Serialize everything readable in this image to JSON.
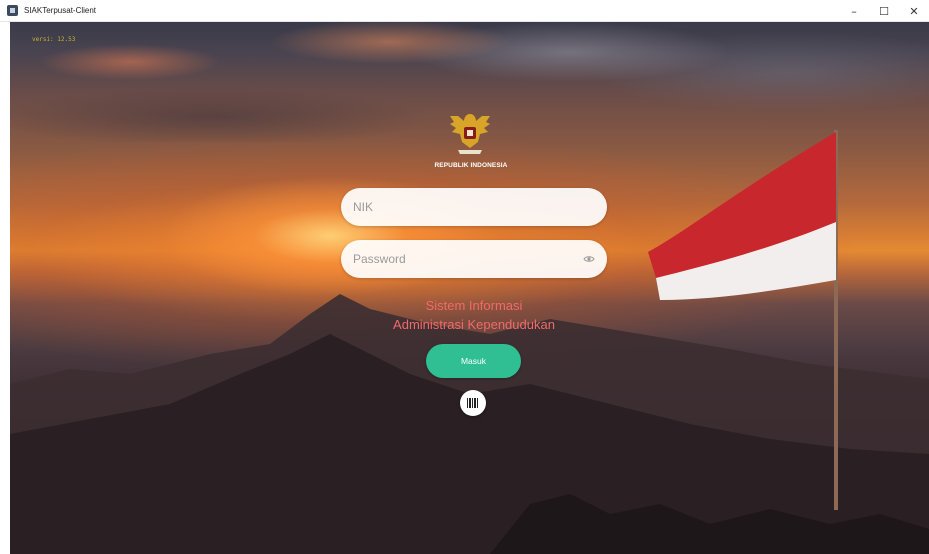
{
  "window": {
    "title": "SIAKTerpusat-Client",
    "controls": {
      "minimize": "–",
      "maximize": "☐",
      "close": "✕"
    }
  },
  "version_label": "versi: 12.53",
  "emblem": {
    "icon": "garuda-emblem-icon",
    "caption": "REPUBLIK INDONESIA"
  },
  "form": {
    "nik": {
      "placeholder": "NIK",
      "value": ""
    },
    "password": {
      "placeholder": "Password",
      "value": "",
      "icon": "eye-icon"
    }
  },
  "heading": {
    "line1": "Sistem Informasi",
    "line2": "Administrasi Kependudukan"
  },
  "buttons": {
    "login_label": "Masuk",
    "barcode_icon": "barcode-icon"
  },
  "colors": {
    "login_button": "#2fbf93",
    "heading": "#f06a6a",
    "flag_red": "#c8272e",
    "flag_white": "#f2eeee"
  }
}
